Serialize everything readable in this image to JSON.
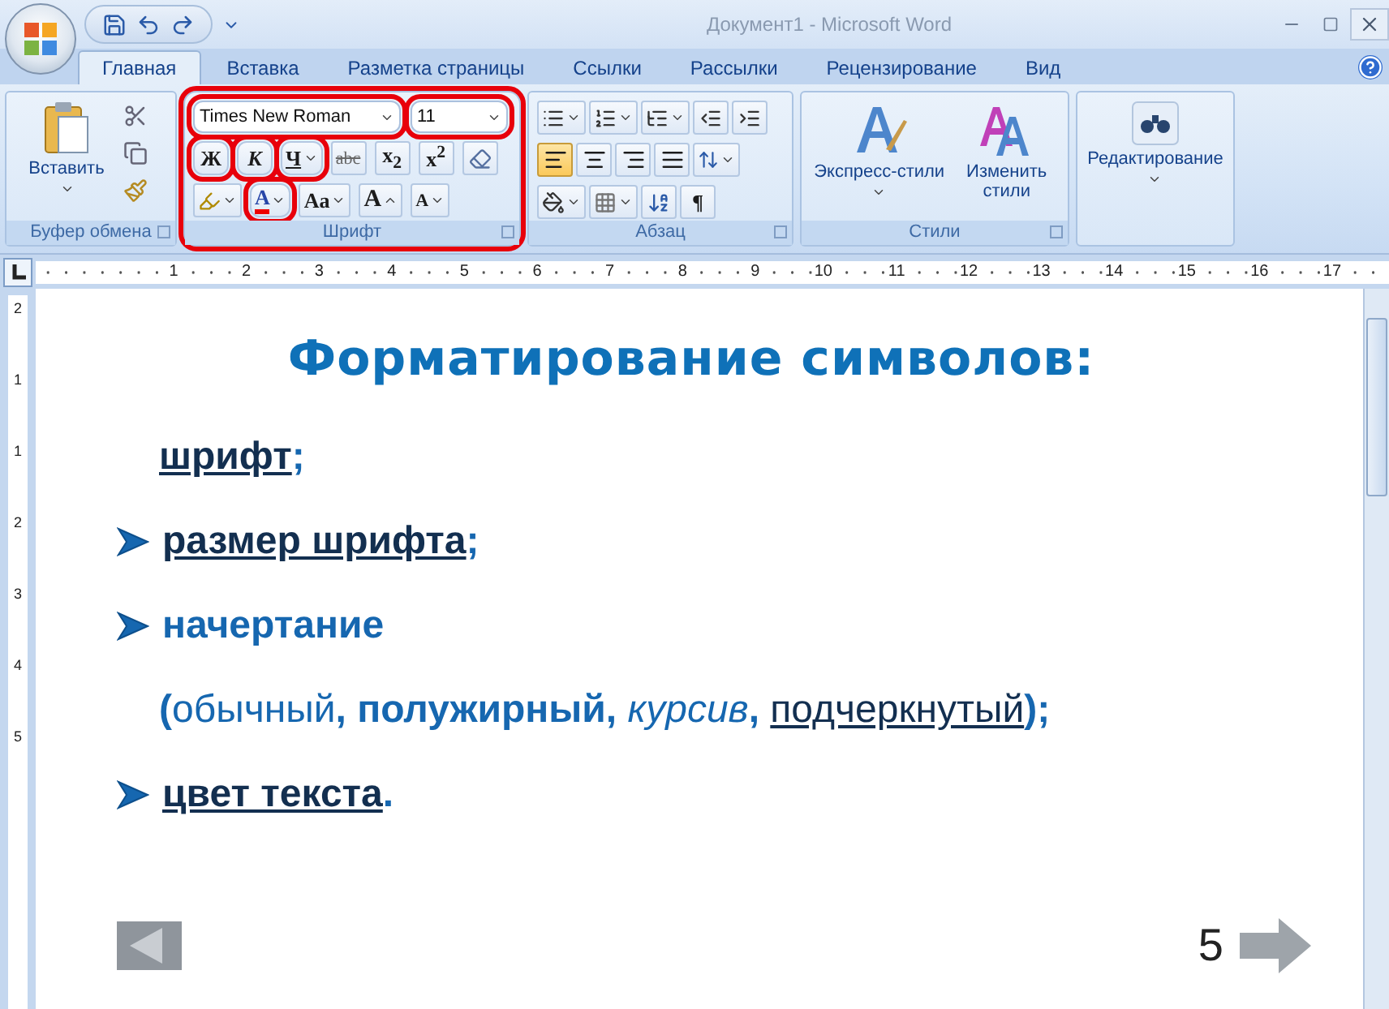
{
  "window": {
    "title": "Документ1 - Microsoft Word"
  },
  "tabs": [
    {
      "label": "Главная",
      "selected": true
    },
    {
      "label": "Вставка",
      "selected": false
    },
    {
      "label": "Разметка страницы",
      "selected": false
    },
    {
      "label": "Ссылки",
      "selected": false
    },
    {
      "label": "Рассылки",
      "selected": false
    },
    {
      "label": "Рецензирование",
      "selected": false
    },
    {
      "label": "Вид",
      "selected": false
    }
  ],
  "ribbon": {
    "clipboard": {
      "paste_label": "Вставить",
      "group_label": "Буфер обмена"
    },
    "font": {
      "highlighted": true,
      "font_name": {
        "value": "Times New Roman",
        "highlighted": true
      },
      "font_size": {
        "value": "11",
        "highlighted": true
      },
      "buttons": [
        {
          "kind": "bold",
          "label": "Ж",
          "highlighted": true
        },
        {
          "kind": "italic",
          "label": "К",
          "highlighted": true
        },
        {
          "kind": "underline",
          "label": "Ч",
          "highlighted": true
        },
        {
          "kind": "strike",
          "label": "abc",
          "highlighted": false
        },
        {
          "kind": "subscript",
          "label": "x$_{2}$",
          "highlighted": false
        },
        {
          "kind": "superscript",
          "label": "x$^{2}$",
          "highlighted": false
        }
      ],
      "color": {
        "label": "A",
        "highlighted": true
      },
      "change_case": "Aa",
      "grow": "A",
      "shrink": "A",
      "group_label": "Шрифт"
    },
    "paragraph": {
      "align": [
        {
          "kind": "left",
          "selected": true
        },
        {
          "kind": "center",
          "selected": false
        },
        {
          "kind": "right",
          "selected": false
        },
        {
          "kind": "justify",
          "selected": false
        }
      ],
      "pilcrow": "¶",
      "group_label": "Абзац"
    },
    "styles": {
      "quick_styles": "Экспресс-стили",
      "change_styles": "Изменить стили",
      "group_label": "Стили"
    },
    "editing": {
      "label": "Редактирование"
    }
  },
  "ruler": [
    "1",
    "2",
    "3",
    "4",
    "5",
    "6",
    "7",
    "8",
    "9",
    "10",
    "11",
    "12",
    "13",
    "14",
    "15",
    "16",
    "17"
  ],
  "vertical_ruler": [
    "2",
    "1",
    "1",
    "2",
    "3",
    "4",
    "5"
  ],
  "slide": {
    "title": "Форматирование символов:",
    "items": [
      {
        "bullet": false,
        "segments": [
          {
            "text": "шрифт",
            "kind": "underlined"
          },
          {
            "text": ";",
            "kind": "bold"
          }
        ]
      },
      {
        "bullet": true,
        "segments": [
          {
            "text": "размер шрифта",
            "kind": "underlined"
          },
          {
            "text": ";",
            "kind": "bold"
          }
        ]
      },
      {
        "bullet": true,
        "segments": [
          {
            "text": "начертание",
            "kind": "bold"
          }
        ]
      },
      {
        "bullet": false,
        "segments": [
          {
            "text": "(",
            "kind": "bold"
          },
          {
            "text": "обычный",
            "kind": "regular"
          },
          {
            "text": ", ",
            "kind": "bold"
          },
          {
            "text": "полужирный",
            "kind": "bold"
          },
          {
            "text": ", ",
            "kind": "bold"
          },
          {
            "text": "курсив",
            "kind": "italic"
          },
          {
            "text": ", ",
            "kind": "bold"
          },
          {
            "text": "подчеркнутый",
            "kind": "underlined_regular"
          },
          {
            "text": ");",
            "kind": "bold"
          }
        ]
      },
      {
        "bullet": true,
        "segments": [
          {
            "text": " цвет текста",
            "kind": "underlined"
          },
          {
            "text": ".",
            "kind": "bold"
          }
        ]
      }
    ],
    "page": "5"
  }
}
